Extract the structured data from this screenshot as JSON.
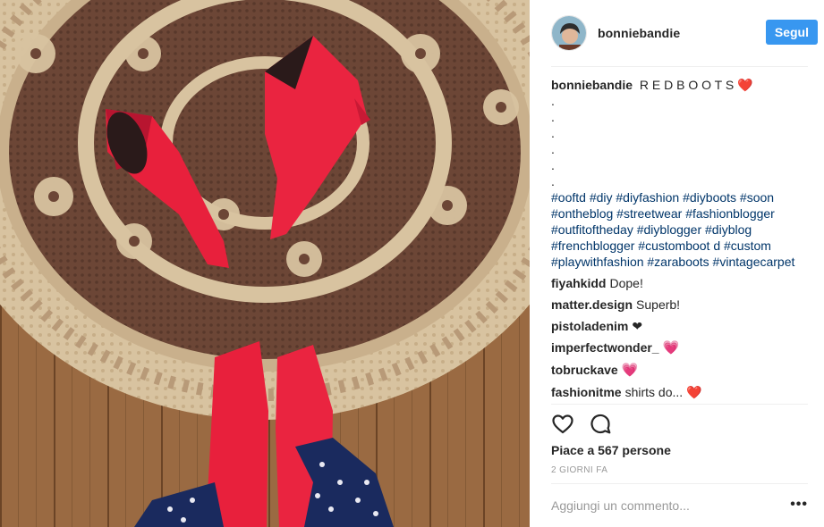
{
  "post": {
    "username": "bonniebandie",
    "follow_label": "Segul",
    "caption_user": "bonniebandie",
    "caption_text": "R E D B O O T S",
    "caption_emoji": "❤️",
    "dots": [
      ".",
      ".",
      ".",
      ".",
      ".",
      "."
    ],
    "hashtags": "#ooftd #diy #diyfashion #diyboots #soon #ontheblog #streetwear #fashionblogger #outfitoftheday #diyblogger #diyblog #frenchblogger #customboot d #custom #playwithfashion #zaraboots #vintagecarpet"
  },
  "comments": [
    {
      "user": "fiyahkidd",
      "text": "Dope!"
    },
    {
      "user": "matter.design",
      "text": "Superb!"
    },
    {
      "user": "pistoladenim",
      "text": "❤"
    },
    {
      "user": "imperfectwonder_",
      "text": "💗"
    },
    {
      "user": "tobruckave",
      "text": "💗"
    },
    {
      "user": "fashionitme",
      "text": "shirts do... ❤️"
    }
  ],
  "actions": {
    "like_icon": "heart-outline-icon",
    "comment_icon": "comment-bubble-icon"
  },
  "likes_text": "Piace a 567 persone",
  "time_text": "2 GIORNI FA",
  "comment_placeholder": "Aggiungi un commento...",
  "more_label": "•••",
  "colors": {
    "accent": "#3897f0",
    "hashtag": "#003569",
    "boot_red": "#e8203c",
    "heart": "#e0245e"
  }
}
